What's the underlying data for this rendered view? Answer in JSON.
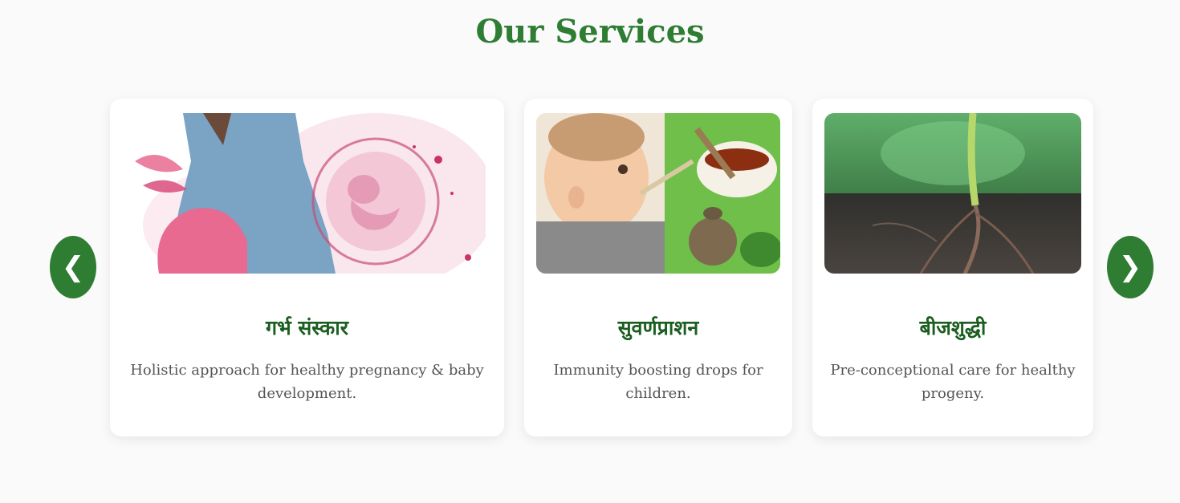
{
  "section": {
    "title": "Our Services"
  },
  "nav": {
    "prev_icon": "❮",
    "next_icon": "❯"
  },
  "colors": {
    "accent": "#2e7d32",
    "title_dark": "#1b5e20",
    "background": "#fafafa",
    "card": "#ffffff"
  },
  "services": [
    {
      "image": "pregnancy-illustration",
      "title": "गर्भ संस्कार",
      "description": "Holistic approach for healthy pregnancy & baby development."
    },
    {
      "image": "baby-feeding-photo",
      "title": "सुवर्णप्राशन",
      "description": "Immunity boosting drops for children."
    },
    {
      "image": "seedling-photo",
      "title": "बीजशुद्धी",
      "description": "Pre-conceptional care for healthy progeny."
    }
  ]
}
